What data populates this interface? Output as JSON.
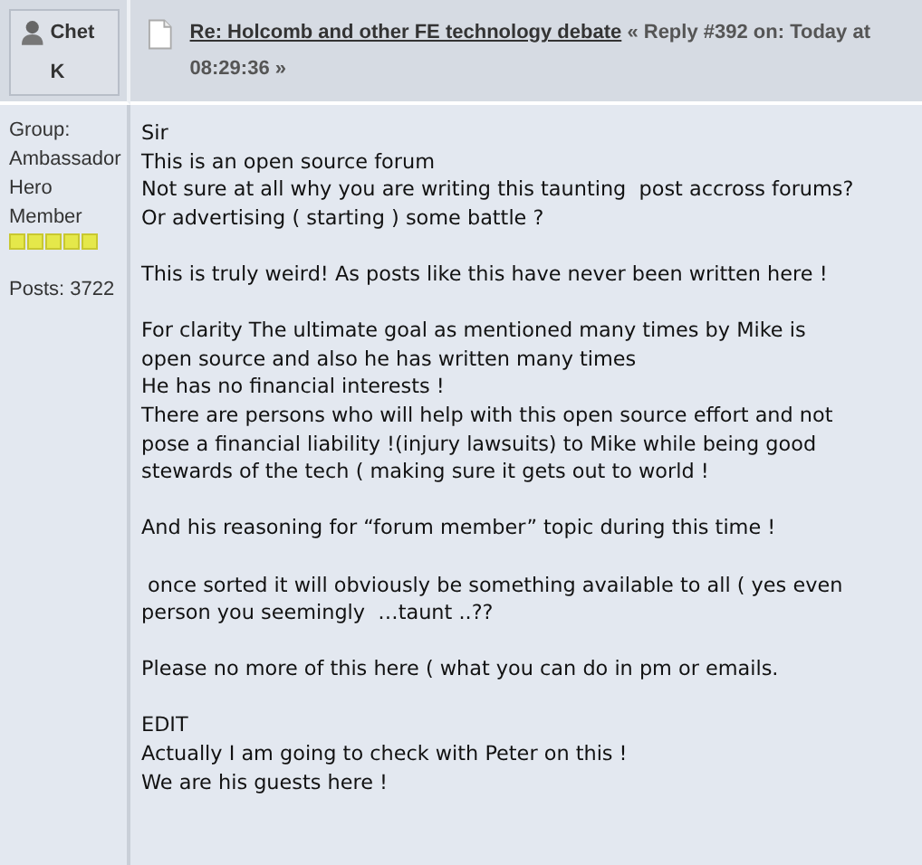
{
  "poster": {
    "name": "Chet K",
    "group_label": "Group:",
    "group": "Ambassador Hero Member",
    "stars": 5,
    "posts": "Posts: 3722"
  },
  "header": {
    "title": "Re: Holcomb and other FE technology debate",
    "meta": "« Reply #392 on: Today at 08:29:36 »"
  },
  "body": [
    [
      "Sir",
      "This is an open source forum",
      "Not sure at all why you are writing this taunting  post accross forums?",
      "Or advertising ( starting ) some battle ?"
    ],
    [
      "This is truly weird! As posts like this have never been written here !"
    ],
    [
      "For clarity The ultimate goal as mentioned many times by Mike is",
      "open source and also he has written many times",
      "He has no financial interests !",
      "There are persons who will help with this open source effort and not",
      "pose a financial liability !(injury lawsuits) to Mike while being good",
      "stewards of the tech ( making sure it gets out to world !"
    ],
    [
      "And his reasoning for “forum member” topic during this time !"
    ],
    [
      " once sorted it will obviously be something available to all ( yes even",
      "person you seemingly  …taunt ..??"
    ],
    [
      "Please no more of this here ( what you can do in pm or emails."
    ],
    [
      "EDIT",
      "Actually I am going to check with Peter on this !",
      "We are his guests here !"
    ]
  ]
}
